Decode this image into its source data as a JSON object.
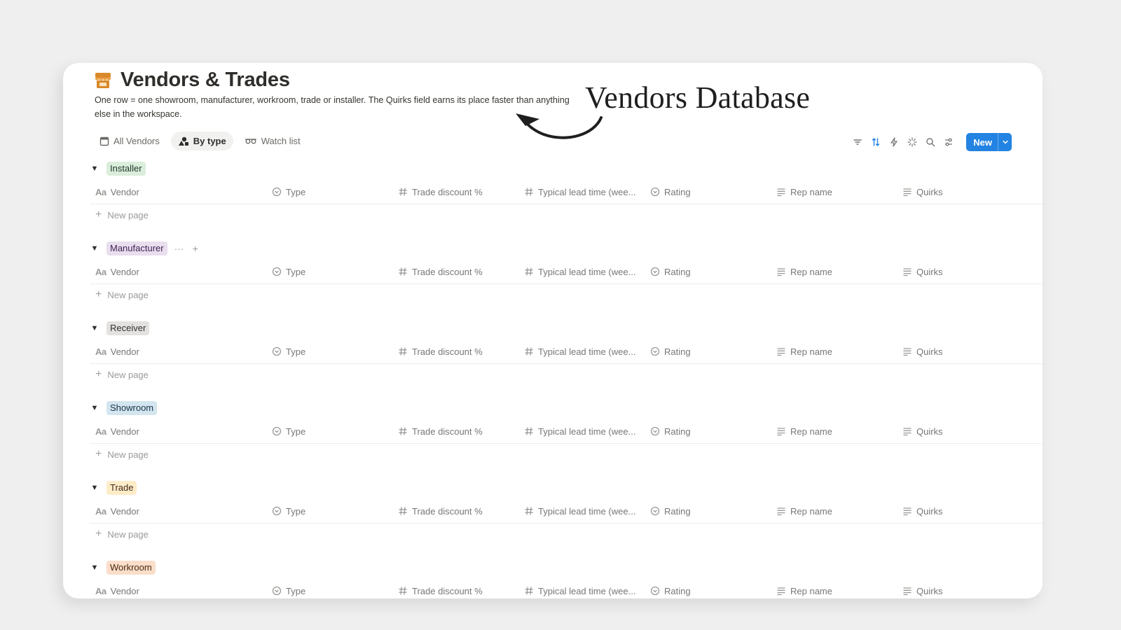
{
  "page": {
    "title": "Vendors & Trades",
    "description": "One row = one showroom, manufacturer, workroom, trade or installer. The Quirks field earns its place faster than anything else in the workspace.",
    "annotation": "Vendors Database",
    "icon": "storefront-icon"
  },
  "views": [
    {
      "label": "All Vendors",
      "icon": "table-icon",
      "active": false
    },
    {
      "label": "By type",
      "icon": "board-icon",
      "active": true
    },
    {
      "label": "Watch list",
      "icon": "glasses-icon",
      "active": false
    }
  ],
  "toolbar": {
    "icons": [
      "filter-icon",
      "sort-icon",
      "automation-icon",
      "ai-sparkle-icon",
      "search-icon",
      "settings-icon"
    ],
    "new_label": "New",
    "accent": "#2383e2"
  },
  "columns": {
    "vendor": "Vendor",
    "type": "Type",
    "discount": "Trade discount %",
    "lead": "Typical lead time (wee...",
    "rating": "Rating",
    "rep": "Rep name",
    "quirks": "Quirks"
  },
  "new_page_label": "New page",
  "groups": [
    {
      "label": "Installer",
      "bg": "#dbeddb",
      "fg": "#1c3829"
    },
    {
      "label": "Manufacturer",
      "bg": "#e8deee",
      "fg": "#412454"
    },
    {
      "label": "Receiver",
      "bg": "#e3e2e0",
      "fg": "#32302c"
    },
    {
      "label": "Showroom",
      "bg": "#d3e5ef",
      "fg": "#183347"
    },
    {
      "label": "Trade",
      "bg": "#fdecc8",
      "fg": "#402c1b"
    },
    {
      "label": "Workroom",
      "bg": "#fadec9",
      "fg": "#49290e"
    }
  ]
}
